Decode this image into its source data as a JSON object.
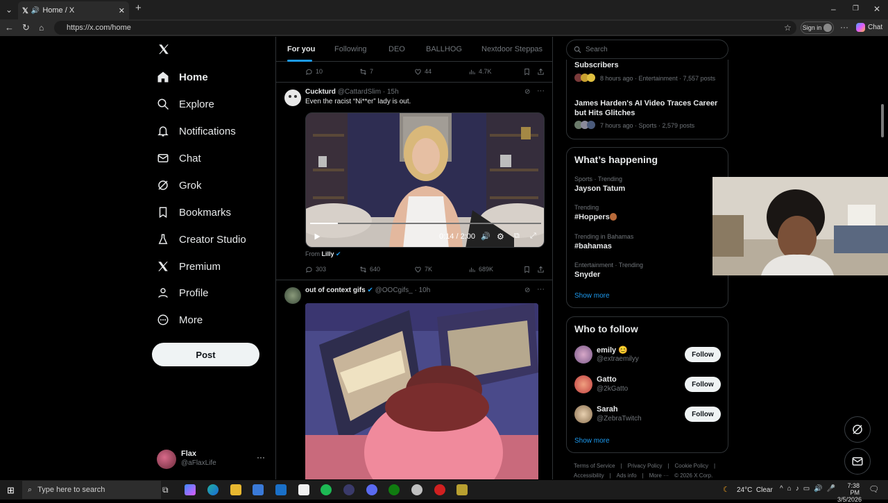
{
  "browser": {
    "tab_title": "Home / X",
    "url": "https://x.com/home",
    "sign_in": "Sign in",
    "chat": "Chat"
  },
  "nav": {
    "items": [
      {
        "label": "Home",
        "icon": "home-icon"
      },
      {
        "label": "Explore",
        "icon": "search-icon"
      },
      {
        "label": "Notifications",
        "icon": "bell-icon"
      },
      {
        "label": "Chat",
        "icon": "mail-icon"
      },
      {
        "label": "Grok",
        "icon": "grok-icon"
      },
      {
        "label": "Bookmarks",
        "icon": "bookmark-icon"
      },
      {
        "label": "Creator Studio",
        "icon": "flask-icon"
      },
      {
        "label": "Premium",
        "icon": "x-icon"
      },
      {
        "label": "Profile",
        "icon": "person-icon"
      },
      {
        "label": "More",
        "icon": "more-circle-icon"
      }
    ],
    "post_button": "Post",
    "account": {
      "name": "Flax",
      "handle": "@aFlaxLife"
    }
  },
  "feed": {
    "tabs": [
      "For you",
      "Following",
      "DEO",
      "BALLHOG",
      "Nextdoor Steppas"
    ],
    "top_actions": {
      "replies": "10",
      "reposts": "7",
      "likes": "44",
      "views": "4.7K"
    },
    "post1": {
      "name": "Cuckturd",
      "handle": "@CattardSlim",
      "time": "· 15h",
      "text": "Even the racist “Ni**er” lady is out.",
      "video_time": "0:14 / 2:00",
      "video_progress": 0.12,
      "from_label": "From",
      "from_name": "Lilly",
      "actions": {
        "replies": "303",
        "reposts": "640",
        "likes": "7K",
        "views": "689K"
      }
    },
    "post2": {
      "name": "out of context gifs",
      "handle": "@OOCgifs_",
      "time": "· 10h"
    }
  },
  "right": {
    "search_placeholder": "Search",
    "top_card": {
      "t1_title": "Subscribers",
      "t1_meta": "8 hours ago · Entertainment · 7,557 posts",
      "t2_title": "James Harden's AI Video Traces Career but Hits Glitches",
      "t2_meta": "7 hours ago · Sports · 2,579 posts"
    },
    "whats_happening": {
      "title": "What’s happening",
      "trends": [
        {
          "category": "Sports · Trending",
          "name": "Jayson Tatum"
        },
        {
          "category": "Trending",
          "name": "#Hoppers"
        },
        {
          "category": "Trending in Bahamas",
          "name": "#bahamas"
        },
        {
          "category": "Entertainment · Trending",
          "name": "Snyder"
        }
      ],
      "show_more": "Show more"
    },
    "who_to_follow": {
      "title": "Who to follow",
      "accounts": [
        {
          "name": "emily 😊",
          "handle": "@extraemilyy"
        },
        {
          "name": "Gatto",
          "handle": "@2kGatto"
        },
        {
          "name": "Sarah",
          "handle": "@ZebraTwitch"
        }
      ],
      "follow_label": "Follow",
      "show_more": "Show more"
    },
    "footer": {
      "line1": [
        "Terms of Service",
        "|",
        "Privacy Policy",
        "|",
        "Cookie Policy",
        "|"
      ],
      "line2": [
        "Accessibility",
        "|",
        "Ads info",
        "|",
        "More ···",
        "© 2026 X Corp."
      ]
    }
  },
  "taskbar": {
    "search_placeholder": "Type here to search",
    "weather": "24°C  Clear",
    "time": "7:38 PM",
    "date": "3/5/2026"
  },
  "colors": {
    "accent": "#1d9bf0",
    "background": "#000000",
    "border": "#2f3336"
  }
}
